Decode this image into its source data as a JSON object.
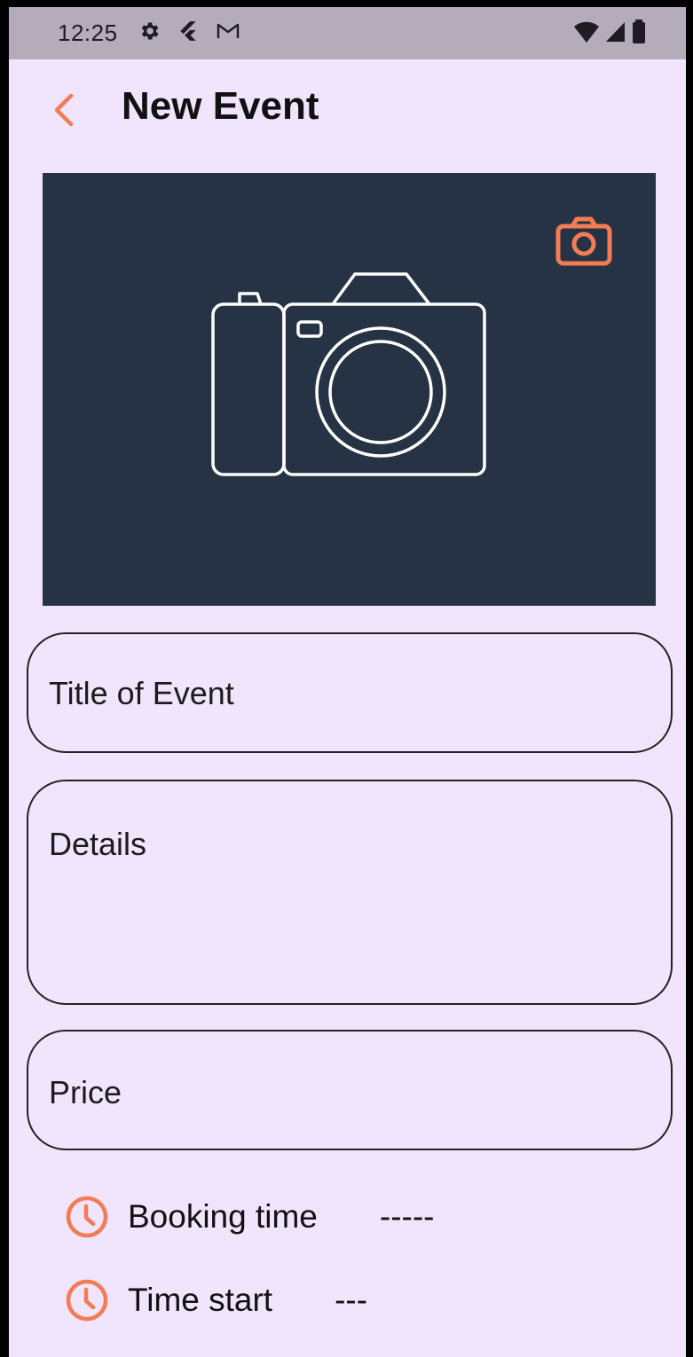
{
  "status_bar": {
    "time": "12:25",
    "left_icons": [
      "gear-icon",
      "flutter-icon",
      "gmail-icon"
    ],
    "right_icons": [
      "wifi-icon",
      "signal-icon",
      "battery-icon"
    ]
  },
  "app_bar": {
    "title": "New Event",
    "back_icon": "chevron-left-icon"
  },
  "image_picker": {
    "placeholder_icon": "camera-illustration",
    "action_icon": "camera-icon"
  },
  "form": {
    "title_placeholder": "Title of Event",
    "details_placeholder": "Details",
    "price_placeholder": "Price"
  },
  "times": {
    "booking_label": "Booking time",
    "booking_value": "-----",
    "start_label": "Time start",
    "start_value": "---"
  },
  "colors": {
    "accent": "#F47C54",
    "background": "#F1E5FD",
    "image_bg": "#253345",
    "status_bar": "#B4ACBB"
  }
}
